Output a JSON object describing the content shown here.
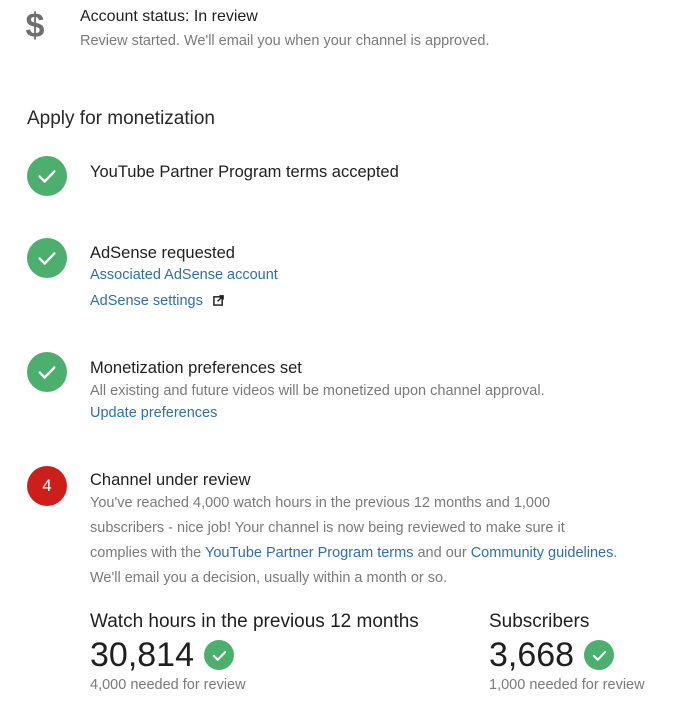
{
  "account": {
    "icon": "dollar-icon",
    "status": "Account status: In review",
    "sub": "Review started. We'll email you when your channel is approved."
  },
  "section_title": "Apply for monetization",
  "steps": [
    {
      "icon": "check-icon",
      "title": "YouTube Partner Program terms accepted"
    },
    {
      "icon": "check-icon",
      "title": "AdSense requested",
      "link1": "Associated AdSense account",
      "link2": "AdSense settings",
      "link2_icon": "external-link-icon"
    },
    {
      "icon": "check-icon",
      "title": "Monetization preferences set",
      "text": "All existing and future videos will be monetized upon channel approval.",
      "link1": "Update preferences"
    },
    {
      "number": "4",
      "title": "Channel under review",
      "text_line1": "You've reached 4,000 watch hours in the previous 12 months and 1,000",
      "text_line2": "subscribers - nice job! Your channel is now being reviewed to make sure it",
      "text_line3_pre": "complies with the ",
      "text_line3_link1": "YouTube Partner Program terms",
      "text_line3_mid": " and our ",
      "text_line3_link2": "Community guidelines",
      "text_line3_post": ".",
      "text_line4": "We'll email you a decision, usually within a month or so."
    }
  ],
  "stats": {
    "watch_hours": {
      "label": "Watch hours in the previous 12 months",
      "value": "30,814",
      "sub": "4,000 needed for review"
    },
    "subscribers": {
      "label": "Subscribers",
      "value": "3,668",
      "sub": "1,000 needed for review"
    }
  },
  "colors": {
    "check_green": "#4caf6e",
    "step_red": "#cc1f1a",
    "link_blue": "#2e6fb0"
  }
}
